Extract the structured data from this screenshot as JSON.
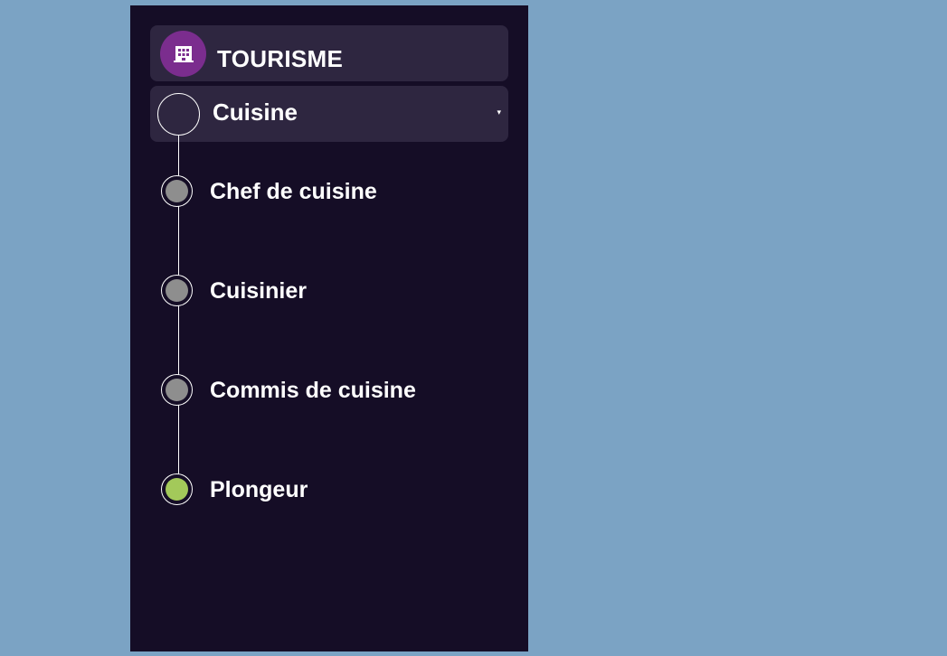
{
  "sector": {
    "icon": "building-icon",
    "title": "TOURISME"
  },
  "category": {
    "label": "Cuisine",
    "caret": "▾"
  },
  "jobs": [
    {
      "label": "Chef de cuisine",
      "status_color": "#8e8e8e"
    },
    {
      "label": "Cuisinier",
      "status_color": "#8e8e8e"
    },
    {
      "label": "Commis de cuisine",
      "status_color": "#8e8e8e"
    },
    {
      "label": "Plongeur",
      "status_color": "#a3c95a"
    }
  ],
  "colors": {
    "background": "#7ba3c4",
    "panel": "#150d26",
    "header_bar": "#2e2640",
    "sector_icon": "#7b2d8e",
    "inactive_dot": "#8e8e8e",
    "active_dot": "#a3c95a"
  }
}
